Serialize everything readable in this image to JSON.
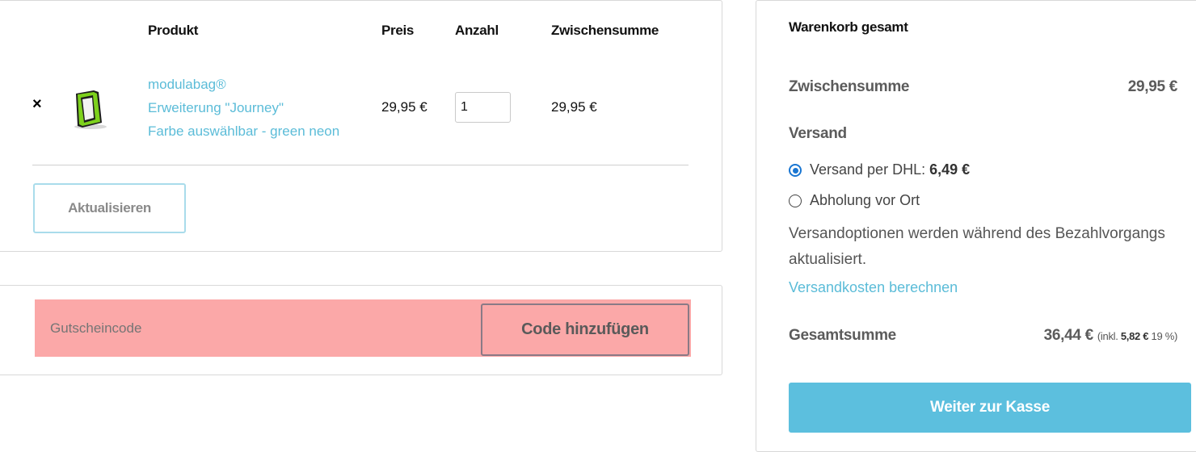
{
  "cart": {
    "headers": {
      "product": "Produkt",
      "price": "Preis",
      "quantity": "Anzahl",
      "subtotal": "Zwischensumme"
    },
    "item": {
      "remove_icon": "×",
      "thumbnail_icon": "bag-frame-icon",
      "name_line1": "modulabag®",
      "name_line2": "Erweiterung \"Journey\"",
      "name_line3": "Farbe auswählbar - green neon",
      "price": "29,95 €",
      "quantity": "1",
      "subtotal": "29,95 €"
    },
    "update_button": "Aktualisieren"
  },
  "coupon": {
    "placeholder": "Gutscheincode",
    "button": "Code hinzufügen"
  },
  "totals": {
    "title": "Warenkorb gesamt",
    "subtotal_label": "Zwischensumme",
    "subtotal_value": "29,95 €",
    "shipping_label": "Versand",
    "shipping_options": [
      {
        "label": "Versand per DHL: ",
        "price": "6,49 €",
        "selected": true
      },
      {
        "label": "Abholung vor Ort",
        "selected": false
      }
    ],
    "shipping_note": "Versandoptionen werden während des Bezahlvorgangs aktualisiert.",
    "calc_link": "Versandkosten berechnen",
    "total_label": "Gesamtsumme",
    "total_value": "36,44 €",
    "tax_prefix": "(inkl. ",
    "tax_value": "5,82 €",
    "tax_suffix": " 19 %)",
    "checkout_button": "Weiter zur Kasse"
  },
  "colors": {
    "accent": "#5cbfde",
    "link": "#5bbcd8",
    "radio": "#1976d2",
    "coupon_highlight": "#fba8a8"
  }
}
